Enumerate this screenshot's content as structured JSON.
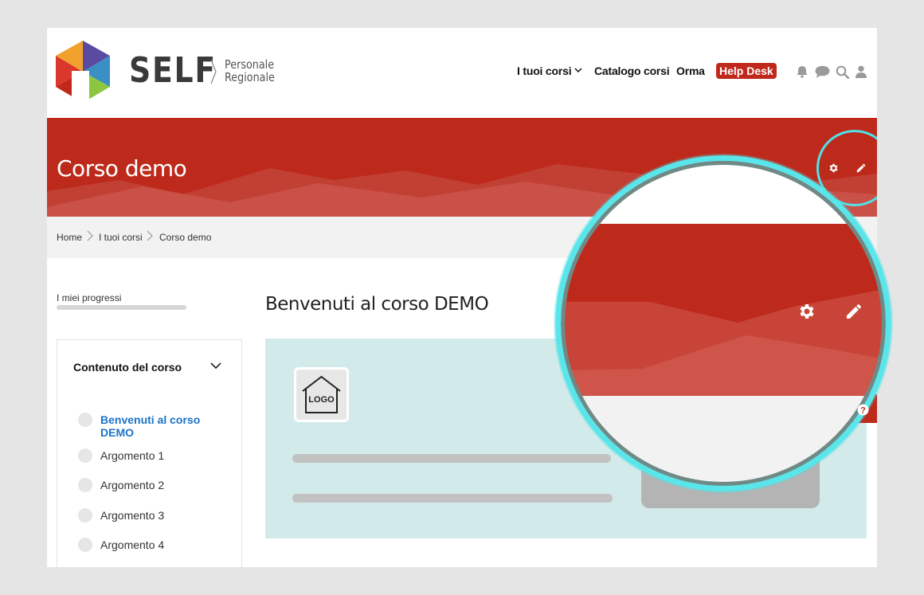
{
  "header": {
    "brand": "SELF",
    "brand_sub_line1": "Personale",
    "brand_sub_line2": "Regionale",
    "nav": {
      "courses": "I tuoi corsi",
      "catalog": "Catalogo corsi",
      "orma": "Orma",
      "helpdesk": "Help Desk"
    },
    "icons": [
      "bell-icon",
      "chat-icon",
      "search-icon",
      "user-icon"
    ]
  },
  "banner": {
    "title": "Corso demo",
    "color": "#bd2a1c"
  },
  "breadcrumb": [
    "Home",
    "I tuoi corsi",
    "Corso demo"
  ],
  "progress": {
    "label": "I miei progressi",
    "value": 0
  },
  "course_index": {
    "title": "Contenuto del corso",
    "items": [
      {
        "label": "Benvenuti al corso DEMO",
        "active": true
      },
      {
        "label": "Argomento 1",
        "active": false
      },
      {
        "label": "Argomento 2",
        "active": false
      },
      {
        "label": "Argomento 3",
        "active": false
      },
      {
        "label": "Argomento 4",
        "active": false
      }
    ]
  },
  "main": {
    "title": "Benvenuti al corso DEMO",
    "logo_text": "LOGO"
  },
  "colors": {
    "accent_red": "#bd2a1c",
    "highlight_ring": "#4fe3e8",
    "link_blue": "#1a73c9",
    "panel_bg": "#d3eaea"
  }
}
